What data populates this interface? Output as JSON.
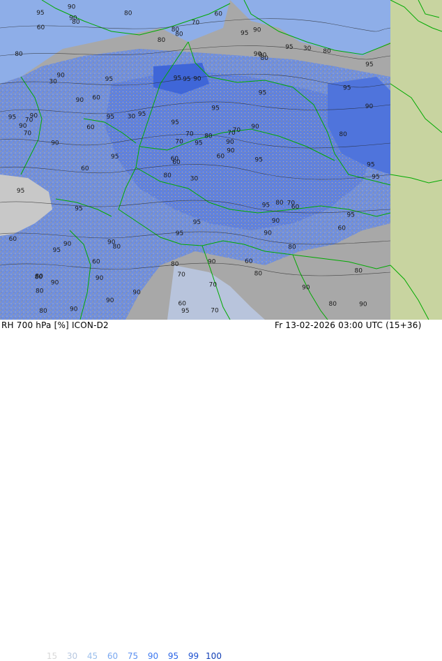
{
  "header": {
    "product": "RH 700 hPa [%] ICON-D2",
    "valid_time": "Fr 13-02-2026 03:00 UTC (15+36)"
  },
  "legend": {
    "values": [
      "15",
      "30",
      "45",
      "60",
      "75",
      "90",
      "95",
      "99",
      "100"
    ],
    "colors": [
      "#d8d8d8",
      "#b8c8e0",
      "#9cc0ec",
      "#7aa8f0",
      "#5a8ff0",
      "#3c78f0",
      "#2862e6",
      "#1a4fd0",
      "#0e3cb4"
    ]
  },
  "map": {
    "land_color": "#a0a0a0",
    "sea_color": "#8eaee8",
    "border_color": "#00aa00",
    "outside_domain_color": "#c8d4a0",
    "contour_levels": [
      "30",
      "45",
      "60",
      "70",
      "80",
      "90",
      "95"
    ],
    "contour_labels": [
      "30",
      "30",
      "60",
      "80",
      "70",
      "80",
      "90",
      "90",
      "90",
      "60",
      "80",
      "90",
      "90",
      "95",
      "80",
      "95",
      "90",
      "95",
      "95",
      "90",
      "95",
      "80",
      "90",
      "95",
      "70",
      "60",
      "90",
      "80",
      "70",
      "95",
      "90",
      "60",
      "80",
      "70",
      "95",
      "95",
      "90",
      "80",
      "80",
      "70",
      "60",
      "30",
      "60",
      "90",
      "90",
      "95",
      "90",
      "80",
      "70",
      "90",
      "95",
      "95",
      "80",
      "90",
      "80",
      "60",
      "90",
      "95",
      "90",
      "80",
      "70",
      "95",
      "90",
      "60",
      "30",
      "90",
      "95",
      "80",
      "70",
      "60",
      "95",
      "90",
      "80",
      "95",
      "80",
      "60",
      "90",
      "95",
      "95",
      "70",
      "80",
      "90",
      "95",
      "95",
      "60",
      "80",
      "95",
      "90",
      "70",
      "60",
      "80",
      "95",
      "90",
      "80",
      "95",
      "60",
      "70",
      "95",
      "90",
      "80",
      "60",
      "80",
      "95",
      "90",
      "95"
    ]
  }
}
